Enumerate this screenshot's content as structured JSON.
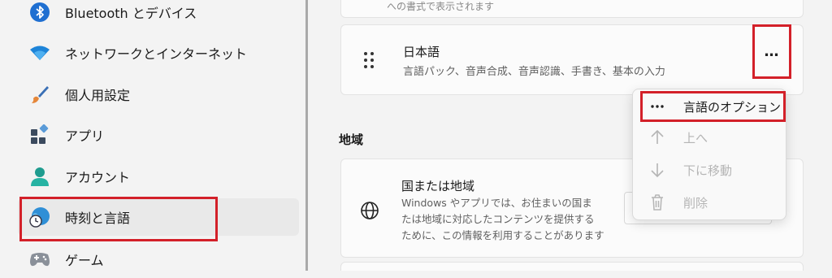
{
  "sidebar": {
    "items": [
      {
        "label": "Bluetooth とデバイス",
        "icon": "bluetooth-icon"
      },
      {
        "label": "ネットワークとインターネット",
        "icon": "wifi-icon"
      },
      {
        "label": "個人用設定",
        "icon": "brush-icon"
      },
      {
        "label": "アプリ",
        "icon": "apps-icon"
      },
      {
        "label": "アカウント",
        "icon": "account-icon"
      },
      {
        "label": "時刻と言語",
        "icon": "clock-globe-icon",
        "selected": true
      },
      {
        "label": "ゲーム",
        "icon": "gamepad-icon"
      }
    ]
  },
  "main": {
    "top_card_partial_text": "への書式で表示されます",
    "language_card": {
      "title": "日本語",
      "subtitle": "言語パック、音声合成、音声認識、手書き、基本の入力",
      "more_button": "…"
    },
    "context_menu": {
      "items": [
        {
          "label": "言語のオプション",
          "icon": "more-icon",
          "enabled": true
        },
        {
          "label": "上へ",
          "icon": "arrow-up-icon",
          "enabled": false
        },
        {
          "label": "下に移動",
          "icon": "arrow-down-icon",
          "enabled": false
        },
        {
          "label": "削除",
          "icon": "trash-icon",
          "enabled": false
        }
      ]
    },
    "region_section": {
      "title": "地域",
      "country_card": {
        "title": "国または地域",
        "description_lines": [
          "Windows やアプリでは、お住まいの国ま",
          "たは地域に対応したコンテンツを提供する",
          "ために、この情報を利用することがあります"
        ]
      }
    }
  },
  "colors": {
    "highlight": "#d32029",
    "accent": "#0067c0"
  }
}
